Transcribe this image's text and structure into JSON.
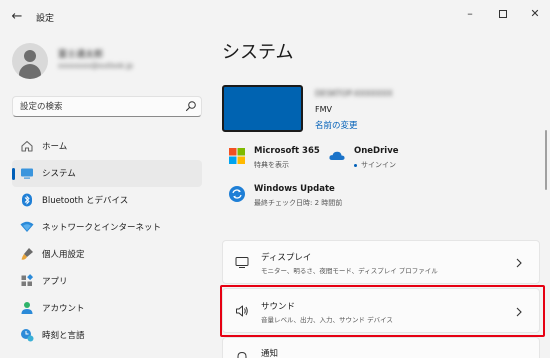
{
  "titlebar": {
    "back_icon": "back-arrow-icon",
    "title": "設定",
    "minimize_icon": "minimize-icon",
    "maximize_icon": "maximize-icon",
    "close_icon": "close-icon"
  },
  "account": {
    "name": "富士通太郎",
    "email": "xxxxxxxx@outlook.jp"
  },
  "search": {
    "placeholder": "設定の検索",
    "icon": "search-icon"
  },
  "nav": {
    "items": [
      {
        "label": "ホーム",
        "icon": "home-icon",
        "selected": false
      },
      {
        "label": "システム",
        "icon": "system-display-icon",
        "selected": true
      },
      {
        "label": "Bluetooth とデバイス",
        "icon": "bluetooth-icon",
        "selected": false
      },
      {
        "label": "ネットワークとインターネット",
        "icon": "wifi-icon",
        "selected": false
      },
      {
        "label": "個人用設定",
        "icon": "paintbrush-icon",
        "selected": false
      },
      {
        "label": "アプリ",
        "icon": "apps-icon",
        "selected": false
      },
      {
        "label": "アカウント",
        "icon": "account-icon",
        "selected": false
      },
      {
        "label": "時刻と言語",
        "icon": "time-language-icon",
        "selected": false
      }
    ],
    "accent_color": "#005fb8"
  },
  "main": {
    "title": "システム",
    "device": {
      "name": "DESKTOP-XXXXXXX",
      "model": "FMV",
      "rename_link": "名前の変更",
      "image_color": "#0063b1"
    },
    "tiles": {
      "ms365": {
        "title": "Microsoft 365",
        "sub": "特典を表示",
        "icon": "microsoft-logo-icon"
      },
      "onedrive": {
        "title": "OneDrive",
        "sub": "サインイン",
        "icon": "cloud-icon"
      },
      "update": {
        "title": "Windows Update",
        "sub": "最終チェック日時: 2 時間前",
        "icon": "update-sync-icon"
      }
    },
    "cards": {
      "display": {
        "title": "ディスプレイ",
        "sub": "モニター、明るさ、夜間モード、ディスプレイ プロファイル",
        "icon": "monitor-icon"
      },
      "sound": {
        "title": "サウンド",
        "sub": "音量レベル、出力、入力、サウンド デバイス",
        "icon": "speaker-icon"
      },
      "notify": {
        "title": "通知",
        "icon": "bell-icon"
      }
    },
    "highlight_color": "#e60012"
  }
}
